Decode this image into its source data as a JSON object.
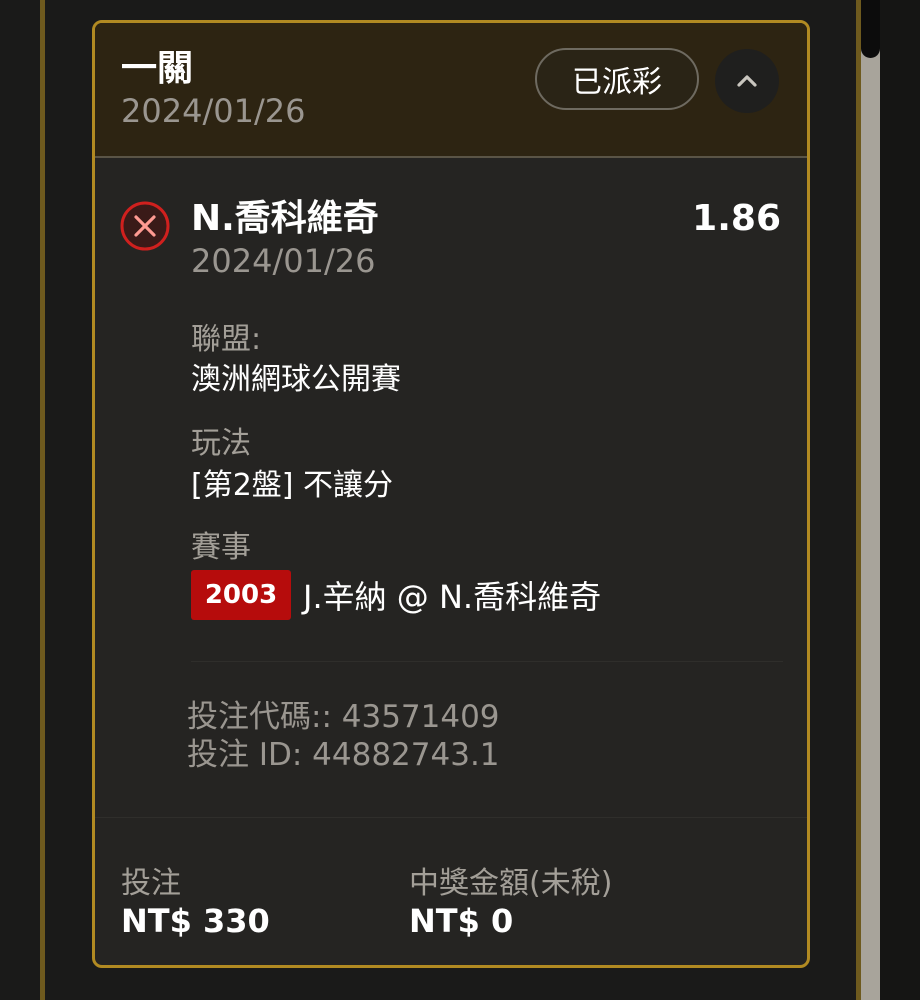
{
  "header": {
    "bet_type": "一關",
    "date": "2024/01/26",
    "status": "已派彩"
  },
  "selection": {
    "result_icon": "lost-x-circle-icon",
    "name": "N.喬科維奇",
    "date": "2024/01/26",
    "odds": "1.86"
  },
  "details": {
    "league_label": "聯盟:",
    "league_value": "澳洲網球公開賽",
    "market_label": "玩法",
    "market_value": "[第2盤] 不讓分",
    "event_label": "賽事",
    "event_code": "2003",
    "event_name": "J.辛納 @ N.喬科維奇"
  },
  "reference": {
    "bet_code": "投注代碼:: 43571409",
    "bet_id": "投注 ID: 44882743.1"
  },
  "footer": {
    "stake_label": "投注",
    "stake_value": "NT$ 330",
    "payout_label": "中獎金額(未稅)",
    "payout_value": "NT$ 0"
  },
  "colors": {
    "accent_gold": "#b18a22",
    "lost_red": "#d0201e",
    "event_badge": "#b60c0c"
  }
}
